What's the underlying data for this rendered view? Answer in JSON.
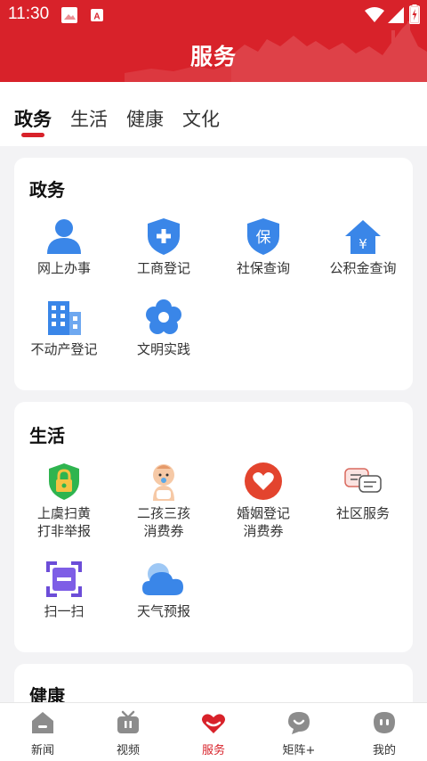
{
  "status_bar": {
    "time": "11:30"
  },
  "header": {
    "title": "服务"
  },
  "tabs": [
    {
      "label": "政务",
      "active": true
    },
    {
      "label": "生活",
      "active": false
    },
    {
      "label": "健康",
      "active": false
    },
    {
      "label": "文化",
      "active": false
    }
  ],
  "sections": [
    {
      "title": "政务",
      "items": [
        {
          "label": "网上办事",
          "icon": "person-icon"
        },
        {
          "label": "工商登记",
          "icon": "shield-plus-icon"
        },
        {
          "label": "社保查询",
          "icon": "shield-bao-icon"
        },
        {
          "label": "公积金查询",
          "icon": "house-yen-icon"
        },
        {
          "label": "不动产登记",
          "icon": "building-icon"
        },
        {
          "label": "文明实践",
          "icon": "flower-icon"
        }
      ]
    },
    {
      "title": "生活",
      "items": [
        {
          "label_lines": [
            "上虞扫黄",
            "打非举报"
          ],
          "icon": "green-shield-lock-icon"
        },
        {
          "label_lines": [
            "二孩三孩",
            "消费券"
          ],
          "icon": "baby-icon"
        },
        {
          "label_lines": [
            "婚姻登记",
            "消费券"
          ],
          "icon": "heart-circle-icon"
        },
        {
          "label": "社区服务",
          "icon": "chat-bubbles-icon"
        },
        {
          "label": "扫一扫",
          "icon": "scan-icon"
        },
        {
          "label": "天气预报",
          "icon": "cloud-icon"
        }
      ]
    },
    {
      "title": "健康"
    }
  ],
  "bottom_nav": [
    {
      "label": "新闻",
      "icon": "home-icon",
      "active": false
    },
    {
      "label": "视频",
      "icon": "tv-icon",
      "active": false
    },
    {
      "label": "服务",
      "icon": "heart-hand-icon",
      "active": true
    },
    {
      "label": "矩阵+",
      "icon": "message-icon",
      "active": false
    },
    {
      "label": "我的",
      "icon": "profile-icon",
      "active": false
    }
  ],
  "colors": {
    "brand_red": "#d8222a",
    "icon_blue": "#3a86e8",
    "page_bg": "#f3f3f5"
  }
}
